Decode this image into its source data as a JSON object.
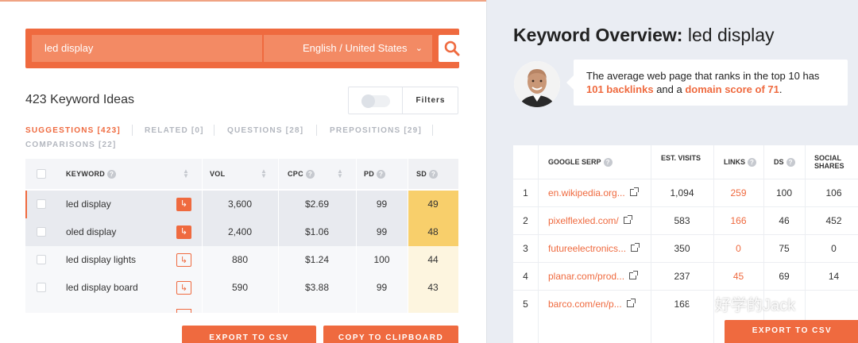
{
  "search": {
    "query": "led display",
    "language": "English / United States"
  },
  "ideas": {
    "title": "423 Keyword Ideas",
    "filters_label": "Filters"
  },
  "tabs": [
    {
      "label": "SUGGESTIONS [423]",
      "active": true
    },
    {
      "label": "RELATED [0]",
      "active": false
    },
    {
      "label": "QUESTIONS [28]",
      "active": false
    },
    {
      "label": "PREPOSITIONS [29]",
      "active": false
    },
    {
      "label": "COMPARISONS [22]",
      "active": false
    }
  ],
  "keyword_table": {
    "columns": [
      "KEYWORD",
      "VOL",
      "CPC",
      "PD",
      "SD"
    ],
    "rows": [
      {
        "keyword": "led display",
        "vol": "3,600",
        "cpc": "$2.69",
        "pd": "99",
        "sd": "49",
        "selected": true
      },
      {
        "keyword": "oled display",
        "vol": "2,400",
        "cpc": "$1.06",
        "pd": "99",
        "sd": "48",
        "selected": true
      },
      {
        "keyword": "led display lights",
        "vol": "880",
        "cpc": "$1.24",
        "pd": "100",
        "sd": "44",
        "selected": false
      },
      {
        "keyword": "led display board",
        "vol": "590",
        "cpc": "$3.88",
        "pd": "99",
        "sd": "43",
        "selected": false
      }
    ]
  },
  "buttons": {
    "export_csv": "EXPORT TO CSV",
    "copy_clipboard": "COPY TO CLIPBOARD",
    "export_csv_right": "EXPORT TO CSV"
  },
  "overview": {
    "title_bold": "Keyword Overview:",
    "title_keyword": "led display",
    "text_1": "The average web page that ranks in the top 10 has",
    "backlinks": "101 backlinks",
    "text_2": "and a",
    "domain_score": "domain score of 71",
    "text_3": "."
  },
  "serp_table": {
    "columns": [
      {
        "label": "GOOGLE SERP",
        "help": true
      },
      {
        "label": "EST. VISITS",
        "help": false
      },
      {
        "label": "LINKS",
        "help": true
      },
      {
        "label": "DS",
        "help": true
      },
      {
        "label": "SOCIAL SHARES",
        "help": false
      }
    ],
    "rows": [
      {
        "rank": "1",
        "url": "en.wikipedia.org...",
        "visits": "1,094",
        "links": "259",
        "ds": "100",
        "shares": "106"
      },
      {
        "rank": "2",
        "url": "pixelflexled.com/",
        "visits": "583",
        "links": "166",
        "ds": "46",
        "shares": "452"
      },
      {
        "rank": "3",
        "url": "futureelectronics...",
        "visits": "350",
        "links": "0",
        "ds": "75",
        "shares": "0"
      },
      {
        "rank": "4",
        "url": "planar.com/prod...",
        "visits": "237",
        "links": "45",
        "ds": "69",
        "shares": "14"
      },
      {
        "rank": "5",
        "url": "barco.com/en/p...",
        "visits": "168",
        "links": "",
        "ds": "",
        "shares": ""
      }
    ]
  },
  "watermark": "好学的Jack",
  "colors": {
    "accent": "#ef6a3f",
    "sd_high": "#f8cf6b",
    "sd_low": "#fdf5df",
    "panel_bg": "#eaedf3"
  }
}
